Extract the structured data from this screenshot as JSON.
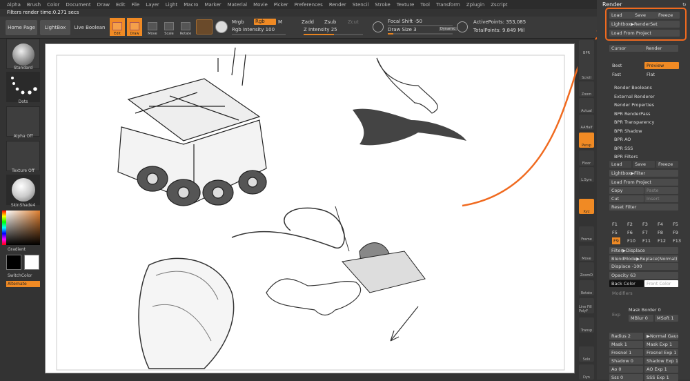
{
  "menu": [
    "Alpha",
    "Brush",
    "Color",
    "Document",
    "Draw",
    "Edit",
    "File",
    "Layer",
    "Light",
    "Macro",
    "Marker",
    "Material",
    "Movie",
    "Picker",
    "Preferences",
    "Render",
    "Stencil",
    "Stroke",
    "Texture",
    "Tool",
    "Transform",
    "Zplugin",
    "Zscript"
  ],
  "status": "Filters render time:0.271 secs",
  "toolbar": {
    "home": "Home Page",
    "lightbox": "LightBox",
    "live_boolean": "Live Boolean",
    "edit": "Edit",
    "draw": "Draw",
    "move": "Move",
    "scale": "Scale",
    "rotate": "Rotate",
    "mrgb": "Mrgb",
    "rgb": "Rgb",
    "m": "M",
    "rgb_intensity": "Rgb Intensity 100",
    "zadd": "Zadd",
    "zsub": "Zsub",
    "zcut": "Zcut",
    "z_intensity": "Z Intensity 25",
    "focal_shift": "Focal Shift -50",
    "draw_size": "Draw Size 3",
    "dynamic": "Dynamic",
    "active_points": "ActivePoints: 353,085",
    "total_points": "TotalPoints: 9.849 Mil"
  },
  "left": {
    "standard": "Standard",
    "dots": "Dots",
    "alpha_off": "Alpha Off",
    "texture_off": "Texture Off",
    "skinshade": "SkinShade4",
    "gradient": "Gradient",
    "switch_color": "SwitchColor",
    "alternate": "Alternate"
  },
  "right_shelf": [
    "BPR",
    "SPix 3",
    "Scroll",
    "Zoom",
    "Actual",
    "AAHalf",
    "Persp",
    "Floor",
    "L.Sym",
    "Xyz",
    "Frame",
    "Move",
    "ZoomD",
    "Rotate",
    "Line Fill PolyF",
    "Transp",
    "Solo",
    "Dyn",
    "Ghost"
  ],
  "panel": {
    "title": "Render",
    "load": "Load",
    "save": "Save",
    "freeze": "Freeze",
    "lightbox_renderset": "Lightbox▶RenderSet",
    "load_from_project": "Load From Project",
    "cursor": "Cursor",
    "render": "Render",
    "best": "Best",
    "preview": "Preview",
    "fast": "Fast",
    "flat": "Flat",
    "sections": [
      "Render Booleans",
      "External Renderer",
      "Render Properties",
      "BPR RenderPass",
      "BPR Transparency",
      "BPR Shadow",
      "BPR AO",
      "BPR SSS",
      "BPR Filters"
    ],
    "lightbox_filter": "Lightbox▶Filter",
    "copy": "Copy",
    "paste": "Paste",
    "cut": "Cut",
    "insert": "Insert",
    "reset_filter": "Reset Filter",
    "filters_row1": [
      "F1",
      "F2",
      "F3",
      "F4",
      "F5"
    ],
    "filters_row2": [
      "F5",
      "F6",
      "F7",
      "F8",
      "F9"
    ],
    "filters_row3": [
      "F9",
      "F10",
      "F11",
      "F12",
      "F13"
    ],
    "filter_displace": "Filter▶Displace",
    "blendmode": "BlendMode▶Replace(Normal)",
    "displace": "Displace -100",
    "opacity": "Opacity 63",
    "back_color": "Back Color",
    "front_color": "Front Color",
    "modifiers": "Modifiers",
    "exp": "Exp",
    "mask_border": "Mask Border 0",
    "mblur": "MBlur 0",
    "msoft": "MSoft 1",
    "radius": "Radius 2",
    "normal_gauss": "▶Normal Gaus",
    "mask": "Mask 1",
    "mask_exp": "Mask Exp 1",
    "fresnel": "Fresnel 1",
    "fresnel_exp": "Fresnel Exp 1",
    "shadow": "Shadow 0",
    "shadow_exp": "Shadow Exp 1",
    "ao": "Ao 0",
    "ao_exp": "AO Exp 1",
    "sss": "Sss 0",
    "sss_exp": "SSS Exp 1"
  },
  "colors": {
    "accent": "#f08a24",
    "callout": "#f06a1f"
  }
}
